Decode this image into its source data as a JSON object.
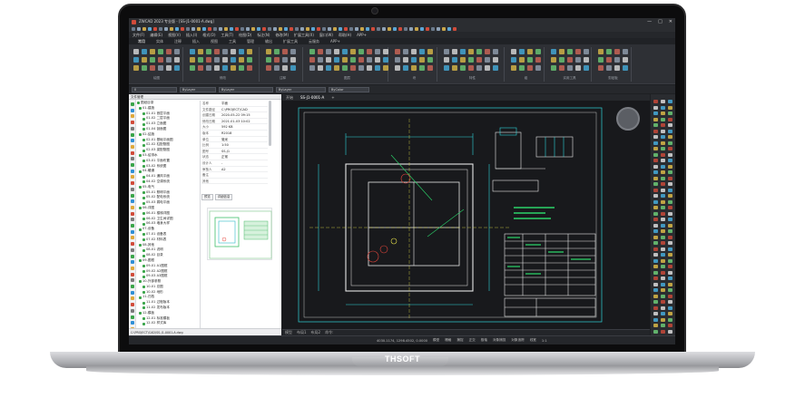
{
  "device": {
    "brand_label": "THSOFT"
  },
  "window": {
    "title": "ZWCAD 2023 专业版 - [SS-J1-0001-A.dwg]",
    "controls": [
      "—",
      "□",
      "✕"
    ]
  },
  "menu": {
    "items": [
      "文件(F)",
      "编辑(E)",
      "视图(V)",
      "插入(I)",
      "格式(O)",
      "工具(T)",
      "绘图(D)",
      "标注(N)",
      "修改(M)",
      "扩展工具(X)",
      "窗口(W)",
      "帮助(H)",
      "APP+"
    ]
  },
  "ribbon_tabs": {
    "items": [
      "常用",
      "实体",
      "注释",
      "插入",
      "视图",
      "工具",
      "管理",
      "输出",
      "扩展工具",
      "云服务",
      "APP+"
    ]
  },
  "ribbon_groups": [
    "绘图",
    "修改",
    "注释",
    "图层",
    "块",
    "特性",
    "组",
    "实用工具",
    "剪贴板"
  ],
  "prop_bar": {
    "layer": "0",
    "color": "ByLayer",
    "linetype": "ByLayer",
    "lineweight": "ByLayer",
    "plot_style": "ByColor"
  },
  "left_panel": {
    "header": "文件管理",
    "tree": [
      "图纸目录",
      "01-建施",
      "01-01 首层平面",
      "01-02 二层平面",
      "01-03 立面图",
      "01-04 剖面图",
      "02-结施",
      "02-01 基础平面图",
      "02-02 柱配筋图",
      "02-03 梁配筋图",
      "03-给排水",
      "03-01 平面布置",
      "03-02 系统图",
      "04-暖通",
      "04-01 通风平面",
      "04-02 空调系统",
      "05-电气",
      "05-01 照明平面",
      "05-02 配电系统",
      "05-03 弱电平面",
      "06-详图",
      "06-01 楼梯详图",
      "06-02 卫生间详图",
      "06-03 墙身大样",
      "07-设备",
      "07-01 设备表",
      "07-02 材料表",
      "08-其他",
      "08-01 说明",
      "08-02 目录",
      "09-图框",
      "09-01 A1图框",
      "09-02 A2图框",
      "09-03 A3图框",
      "10-外部参照",
      "10-01 总图",
      "10-02 地形",
      "11-归档",
      "11-01 过程版本",
      "11-02 发布版本",
      "12-模板",
      "12-01 标准模板",
      "12-02 样式库"
    ],
    "properties": [
      {
        "k": "名称",
        "v": "平面"
      },
      {
        "k": "文件路径",
        "v": "C:\\PROJECT\\CAD"
      },
      {
        "k": "创建日期",
        "v": "2020-05-22 09:15"
      },
      {
        "k": "修改日期",
        "v": "2021-01-03 10:02"
      },
      {
        "k": "大小",
        "v": "592 KB"
      },
      {
        "k": "版本",
        "v": "R2018"
      },
      {
        "k": "单位",
        "v": "毫米"
      },
      {
        "k": "比例",
        "v": "1:50"
      },
      {
        "k": "图号",
        "v": "SS-J1"
      },
      {
        "k": "状态",
        "v": "正常"
      },
      {
        "k": "设计人",
        "v": "-"
      },
      {
        "k": "审核人",
        "v": "A2"
      },
      {
        "k": "备注",
        "v": ""
      },
      {
        "k": "其他",
        "v": ""
      }
    ],
    "preview_tabs": [
      "预览",
      "详细信息"
    ],
    "status": "C:\\PROJECT\\CAD\\SS-J1-0001-A.dwg"
  },
  "drawing": {
    "tabs": [
      "开始",
      "SS-J1-0001-A",
      "+"
    ],
    "layout_tabs": [
      "模型",
      "布局1",
      "布局2"
    ],
    "command_prompt": "命令:"
  },
  "status_bar": {
    "coords": "4030.1174, 1298.4502, 0.0000",
    "toggles": [
      "模型",
      "栅格",
      "捕捉",
      "正交",
      "极轴",
      "对象捕捉",
      "对象追踪",
      "线宽",
      "1:1"
    ]
  },
  "colors": {
    "bg": "#18191c",
    "line_cyan": "#2fd3d8",
    "line_white": "#e6e6e6",
    "line_green": "#2bd46a",
    "line_yellow": "#e5e04a",
    "line_red": "#e6463c"
  }
}
